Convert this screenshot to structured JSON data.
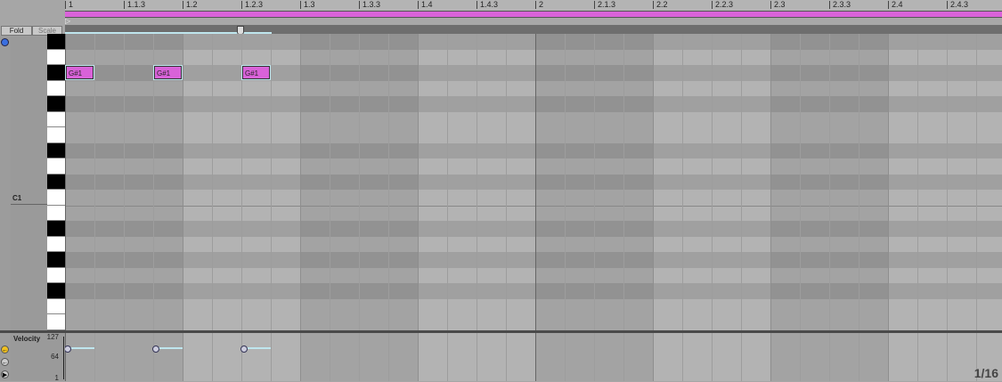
{
  "ruler": {
    "labels": [
      "1",
      "1.1.3",
      "1.2",
      "1.2.3",
      "1.3",
      "1.3.3",
      "1.4",
      "1.4.3",
      "2",
      "2.1.3",
      "2.2",
      "2.2.3",
      "2.3",
      "2.3.3",
      "2.4",
      "2.4.3"
    ]
  },
  "buttons": {
    "fold": "Fold",
    "scale": "Scale"
  },
  "keyboard": {
    "c1_label": "C1",
    "rows": [
      "A#1",
      "A1",
      "G#1",
      "G1",
      "F#1",
      "F1",
      "E1",
      "D#1",
      "D1",
      "C#1",
      "C1",
      "B0",
      "A#0",
      "A0",
      "G#0",
      "G0",
      "F#0",
      "F0",
      "E0",
      "D#0"
    ]
  },
  "notes": [
    {
      "pitch": "G#1",
      "label": "G#1",
      "start": "1",
      "length": "1/16",
      "velocity": 100
    },
    {
      "pitch": "G#1",
      "label": "G#1",
      "start": "1.1.4",
      "length": "1/16",
      "velocity": 100
    },
    {
      "pitch": "G#1",
      "label": "G#1",
      "start": "1.2.3",
      "length": "1/16",
      "velocity": 100
    }
  ],
  "velocity": {
    "title": "Velocity",
    "max": "127",
    "mid": "64",
    "min": "1"
  },
  "grid_label": "1/16",
  "colors": {
    "note": "#d962d9",
    "loop": "#bfe6ee"
  }
}
